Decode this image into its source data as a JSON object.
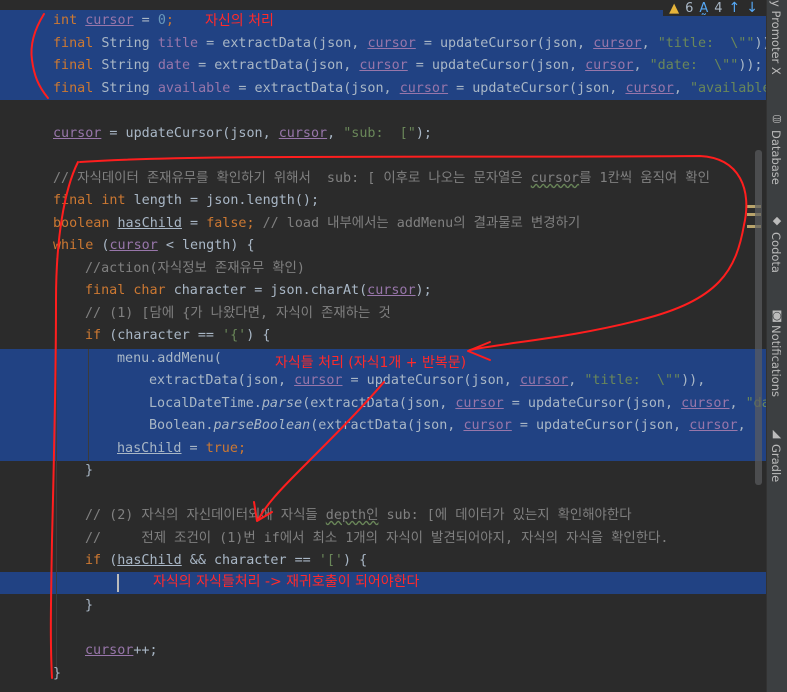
{
  "code": {
    "l1": {
      "t1": "int ",
      "t2": "cursor",
      "t3": " = ",
      "t4": "0",
      "t5": ";"
    },
    "l2": {
      "t1": "final ",
      "t2": "String ",
      "t3": "title",
      "t4": " = extractData(json, ",
      "t5": "cursor",
      "t6": " = updateCursor(json, ",
      "t7": "cursor",
      "t8": ", ",
      "t9": "\"title:  \\\"\"",
      "t10": "));"
    },
    "l3": {
      "t1": "final ",
      "t2": "String ",
      "t3": "date",
      "t4": " = extractData(json, ",
      "t5": "cursor",
      "t6": " = updateCursor(json, ",
      "t7": "cursor",
      "t8": ", ",
      "t9": "\"date:  \\\"\"",
      "t10": "));"
    },
    "l4": {
      "t1": "final ",
      "t2": "String ",
      "t3": "available",
      "t4": " = extractData(json, ",
      "t5": "cursor",
      "t6": " = updateCursor(json, ",
      "t7": "cursor",
      "t8": ", ",
      "t9": "\"available"
    },
    "l5": {
      "t1": "cursor",
      "t2": " = updateCursor(json, ",
      "t3": "cursor",
      "t4": ", ",
      "t5": "\"sub:  [\"",
      "t6": ");"
    },
    "l6": {
      "t1": "// 자식데이터 존재유무를 확인하기 위해서  sub: [ 이후로 나오는 문자열은 ",
      "t2": "cursor",
      "t3": "를 1칸씩 움직여 확인"
    },
    "l7": {
      "t1": "final ",
      "t2": "int ",
      "t3": "length = json.length();"
    },
    "l8": {
      "t1": "boolean ",
      "t2": "hasChild",
      "t3": " = ",
      "t4": "false",
      "t5": "; ",
      "t6": "// load 내부에서는 addMenu의 결과물로 변경하기"
    },
    "l9": {
      "t1": "while ",
      "t2": "(",
      "t3": "cursor",
      "t4": " < length) {"
    },
    "l10": {
      "t1": "//action(자식정보 존재유무 확인)"
    },
    "l11": {
      "t1": "final ",
      "t2": "char ",
      "t3": "character = json.charAt(",
      "t4": "cursor",
      "t5": ");"
    },
    "l12": {
      "t1": "// (1) [담에 {가 나왔다면, 자식이 존재하는 것"
    },
    "l13": {
      "t1": "if ",
      "t2": "(character == ",
      "t3": "'{'",
      "t4": ") {"
    },
    "l14": {
      "t1": "menu.addMenu("
    },
    "l15": {
      "t1": "extractData(json, ",
      "t2": "cursor",
      "t3": " = updateCursor(json, ",
      "t4": "cursor",
      "t5": ", ",
      "t6": "\"title:  \\\"\"",
      "t7": ")),"
    },
    "l16": {
      "t1": "LocalDateTime.",
      "t2": "parse",
      "t3": "(extractData(json, ",
      "t4": "cursor",
      "t5": " = updateCursor(json, ",
      "t6": "cursor",
      "t7": ", ",
      "t8": "\"da"
    },
    "l17": {
      "t1": "Boolean.",
      "t2": "parseBoolean",
      "t3": "(extractData(json, ",
      "t4": "cursor",
      "t5": " = updateCursor(json, ",
      "t6": "cursor",
      "t7": ","
    },
    "l18": {
      "t1": "hasChild",
      "t2": " = ",
      "t3": "true",
      "t4": ";"
    },
    "l19": {
      "t1": "}"
    },
    "l20": {
      "t1": "// (2) 자식의 자신데이터외에 자식들 ",
      "t2": "depth인",
      "t3": " sub: [에 데이터가 있는지 확인해야한다"
    },
    "l21": {
      "t1": "//     전제 조건이 (1)번 if에서 최소 1개의 자식이 발견되어야지, 자식의 자식을 확인한다."
    },
    "l22": {
      "t1": "if ",
      "t2": "(",
      "t3": "hasChild",
      "t4": " && character == ",
      "t5": "'['",
      "t6": ") {"
    },
    "l23": {
      "t1": "}"
    },
    "l24": {
      "t1": "cursor",
      "t2": "++;"
    },
    "l25": {
      "t1": "}"
    }
  },
  "annotations": {
    "a1": "자신의 처리",
    "a2": "자식들 처리 (자식1개 + 반복문)",
    "a3": "자식의 자식들처리 -> 재귀호출이 되어야한다"
  },
  "inspections": {
    "warnings": "6",
    "typos": "4"
  },
  "toolwindows": {
    "promoter": "y Promoter X",
    "database": "Database",
    "codota": "Codota",
    "notifications": "Notifications",
    "gradle": "Gradle"
  },
  "colors": {
    "selection": "#214283",
    "annotation": "#ff2a2a",
    "keyword": "#cc7832",
    "field": "#9876aa",
    "string": "#6a8759",
    "comment": "#808080"
  }
}
